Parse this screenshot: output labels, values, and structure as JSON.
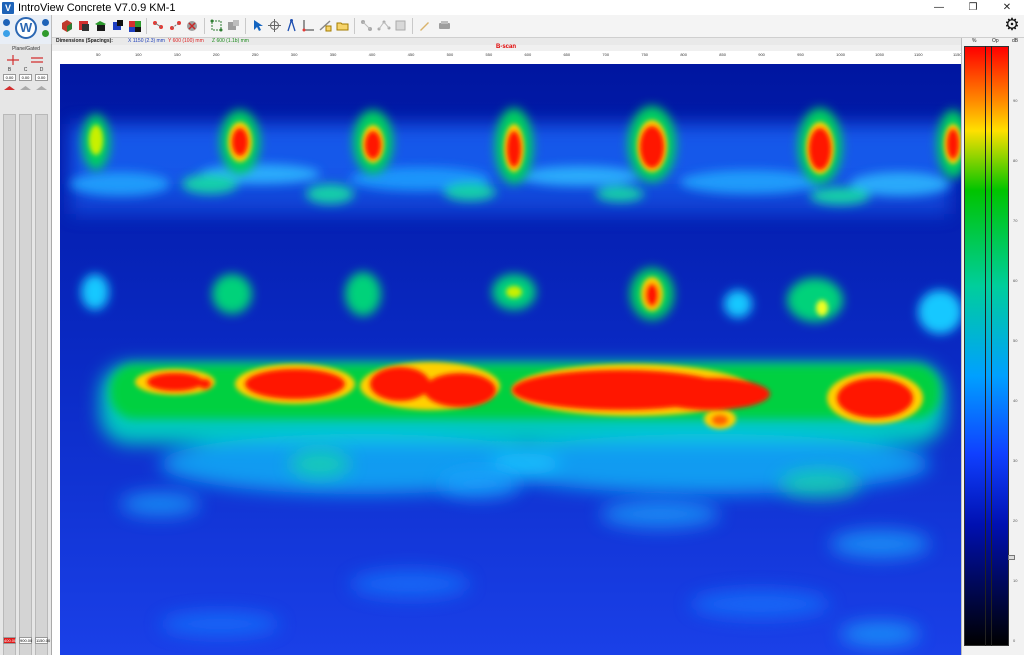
{
  "window": {
    "title": "IntroView Concrete V7.0.9   KM-1",
    "logo_letter": "V",
    "minimize_glyph": "—",
    "maximize_glyph": "❐",
    "close_glyph": "✕"
  },
  "logo": {
    "letter": "W"
  },
  "side_panel": {
    "title": "Plane/Gated",
    "columns": [
      {
        "label": "B",
        "value": "0.00",
        "bottom": "400.00"
      },
      {
        "label": "C",
        "value": "0.00",
        "bottom": "900.00"
      },
      {
        "label": "D",
        "value": "0.00",
        "bottom": "1150.00"
      }
    ]
  },
  "dimensions": {
    "label": "Dimensions (Spacings):",
    "x": "X  1150 (2.3) mm",
    "y": "Y  600 (100) mm",
    "z": "Z  600 (1.1b) mm"
  },
  "scan": {
    "title": "B-scan",
    "x_ticks": [
      "50",
      "100",
      "150",
      "200",
      "250",
      "300",
      "350",
      "400",
      "450",
      "500",
      "550",
      "600",
      "650",
      "700",
      "750",
      "800",
      "850",
      "900",
      "950",
      "1000",
      "1050",
      "1100",
      "1150"
    ]
  },
  "color_scale": {
    "headers": [
      "%",
      "Op",
      "dB"
    ],
    "ticks": [
      "90",
      "80",
      "70",
      "60",
      "50",
      "40",
      "30",
      "20",
      "10",
      "0"
    ]
  },
  "colors": {
    "scan_background": "#0a1aa8",
    "hot": "#ff0000",
    "warm": "#00d800",
    "cool": "#00bfff"
  }
}
